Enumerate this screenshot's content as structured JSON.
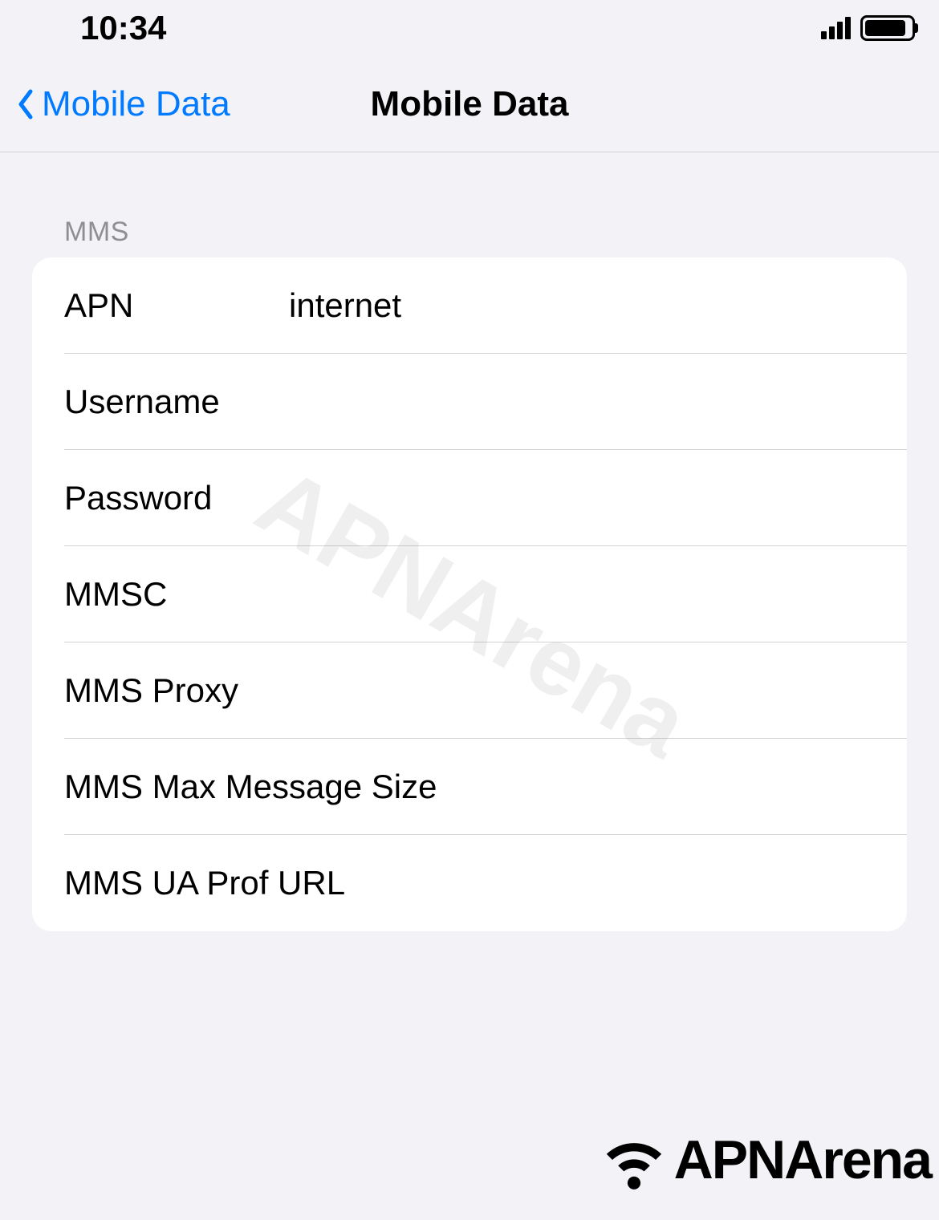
{
  "status_bar": {
    "time": "10:34"
  },
  "nav": {
    "back_label": "Mobile Data",
    "title": "Mobile Data"
  },
  "section": {
    "header": "MMS",
    "rows": [
      {
        "label": "APN",
        "value": "internet"
      },
      {
        "label": "Username",
        "value": ""
      },
      {
        "label": "Password",
        "value": ""
      },
      {
        "label": "MMSC",
        "value": ""
      },
      {
        "label": "MMS Proxy",
        "value": ""
      },
      {
        "label": "MMS Max Message Size",
        "value": ""
      },
      {
        "label": "MMS UA Prof URL",
        "value": ""
      }
    ]
  },
  "watermark": {
    "text": "APNArena"
  },
  "footer": {
    "brand": "APNArena"
  }
}
